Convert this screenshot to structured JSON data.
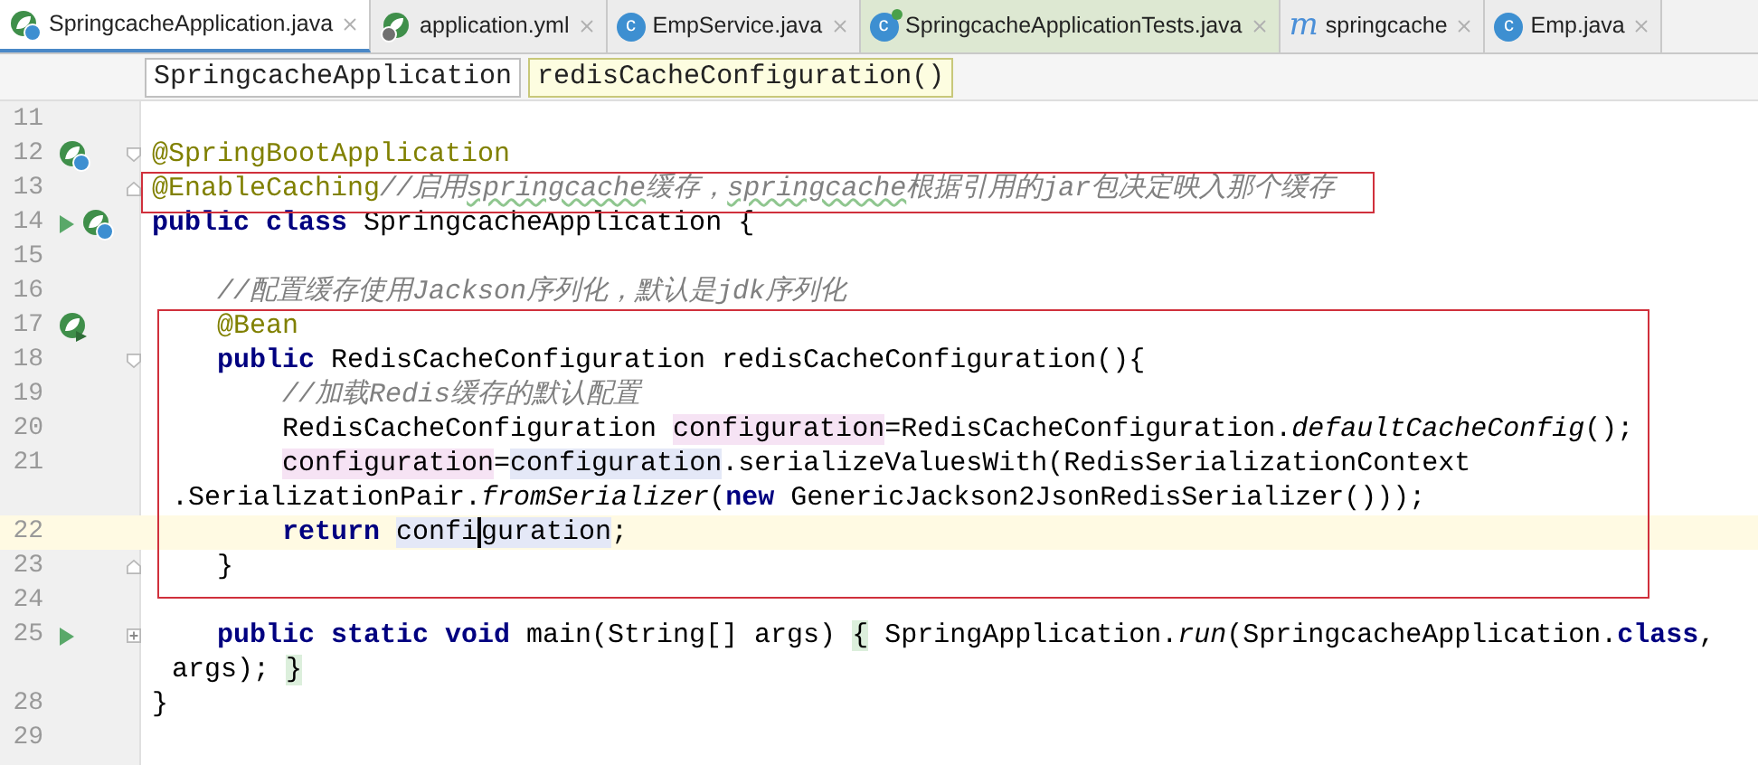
{
  "tabs": [
    {
      "label": "SpringcacheApplication.java",
      "kind": "spring-class",
      "selected": true,
      "color": "#ffffff"
    },
    {
      "label": "application.yml",
      "kind": "spring-config",
      "selected": false,
      "color": "#ececec"
    },
    {
      "label": "EmpService.java",
      "kind": "class",
      "icon_text": "c",
      "selected": false,
      "color": "#ececec"
    },
    {
      "label": "SpringcacheApplicationTests.java",
      "kind": "test-class",
      "icon_text": "c",
      "selected": false,
      "color": "#dde8d2"
    },
    {
      "label": "springcache",
      "kind": "module",
      "icon_text": "m",
      "selected": false,
      "color": "#ececec"
    },
    {
      "label": "Emp.java",
      "kind": "class",
      "icon_text": "c",
      "selected": false,
      "color": "#ececec"
    }
  ],
  "breadcrumbs": [
    {
      "label": "SpringcacheApplication",
      "selected": false
    },
    {
      "label": "redisCacheConfiguration()",
      "selected": true
    }
  ],
  "rows": [
    {
      "kind": "top",
      "number": "11",
      "current": false
    },
    {
      "kind": "top",
      "number": "12",
      "current": false,
      "gutter": [
        {
          "kind": "spring-class"
        }
      ],
      "fold": {
        "kind": "open"
      },
      "segments": [
        {
          "text": "@SpringBootApplication",
          "kind": "annotation"
        }
      ]
    },
    {
      "kind": "top",
      "number": "13",
      "current": false,
      "fold": {
        "kind": "close"
      },
      "box": {
        "kind": "tight"
      },
      "segments": [
        {
          "text": "@EnableCaching",
          "kind": "annotation"
        },
        {
          "text": "//启用",
          "kind": "comment"
        },
        {
          "text": "springcache",
          "kind": "comment",
          "typo": true
        },
        {
          "text": "缓存，",
          "kind": "comment"
        },
        {
          "text": "springcache",
          "kind": "comment",
          "typo": true
        },
        {
          "text": "根据引用的jar包决定映入那个缓存",
          "kind": "comment"
        }
      ]
    },
    {
      "kind": "top",
      "number": "14",
      "current": false,
      "gutter": [
        {
          "kind": "run"
        },
        {
          "kind": "spring-class"
        }
      ],
      "segments": [
        {
          "text": "public class",
          "kind": "keyword"
        },
        {
          "text": " SpringcacheApplication {",
          "kind": "plain"
        }
      ]
    },
    {
      "kind": "top",
      "number": "15",
      "current": false
    },
    {
      "kind": "member",
      "number": "16",
      "current": false,
      "segments": [
        {
          "text": "//配置缓存使用Jackson序列化，默认是jdk序列化",
          "kind": "comment"
        }
      ]
    },
    {
      "kind": "member",
      "number": "17",
      "current": false,
      "gutter": [
        {
          "kind": "bean-method"
        }
      ],
      "box": {
        "kind": "wide"
      },
      "segments": [
        {
          "text": "@Bean",
          "kind": "annotation"
        }
      ]
    },
    {
      "kind": "member",
      "number": "18",
      "current": false,
      "fold": {
        "kind": "open"
      },
      "box": {
        "kind": "wide"
      },
      "segments": [
        {
          "text": "public",
          "kind": "keyword"
        },
        {
          "text": " RedisCacheConfiguration redisCacheConfiguration(){",
          "kind": "plain"
        }
      ]
    },
    {
      "kind": "body",
      "number": "19",
      "current": false,
      "box": {
        "kind": "wide"
      },
      "segments": [
        {
          "text": "//加载Redis缓存的默认配置",
          "kind": "comment"
        }
      ]
    },
    {
      "kind": "body",
      "number": "20",
      "current": false,
      "box": {
        "kind": "wide"
      },
      "segments": [
        {
          "text": "RedisCacheConfiguration ",
          "kind": "plain"
        },
        {
          "text": "configuration",
          "kind": "write"
        },
        {
          "text": "=RedisCacheConfiguration.",
          "kind": "plain"
        },
        {
          "text": "defaultCacheConfig",
          "kind": "static"
        },
        {
          "text": "();",
          "kind": "plain"
        }
      ]
    },
    {
      "kind": "body",
      "number": "21",
      "current": false,
      "box": {
        "kind": "wide"
      },
      "segments": [
        {
          "text": "configuration",
          "kind": "write"
        },
        {
          "text": "=",
          "kind": "plain"
        },
        {
          "text": "configuration",
          "kind": "read"
        },
        {
          "text": ".serializeValuesWith(RedisSerializationContext",
          "kind": "plain"
        }
      ]
    },
    {
      "kind": "wrap",
      "current": false,
      "box": {
        "kind": "wide"
      },
      "segments": [
        {
          "text": ".SerializationPair.",
          "kind": "plain"
        },
        {
          "text": "fromSerializer",
          "kind": "static"
        },
        {
          "text": "(",
          "kind": "plain"
        },
        {
          "text": "new",
          "kind": "keyword"
        },
        {
          "text": " GenericJackson2JsonRedisSerializer()));",
          "kind": "plain"
        }
      ]
    },
    {
      "kind": "body",
      "number": "22",
      "current": true,
      "box": {
        "kind": "wide"
      },
      "segments": [
        {
          "text": "return ",
          "kind": "keyword"
        },
        {
          "text": "confi",
          "kind": "read"
        },
        {
          "text": "guration",
          "kind": "read",
          "caret": true
        },
        {
          "text": ";",
          "kind": "plain"
        }
      ]
    },
    {
      "kind": "member",
      "number": "23",
      "current": false,
      "fold": {
        "kind": "close"
      },
      "box": {
        "kind": "wide"
      },
      "segments": [
        {
          "text": "}",
          "kind": "plain"
        }
      ]
    },
    {
      "kind": "top",
      "number": "24",
      "current": false
    },
    {
      "kind": "member",
      "number": "25",
      "current": false,
      "gutter": [
        {
          "kind": "run"
        }
      ],
      "fold": {
        "kind": "collapsed"
      },
      "segments": [
        {
          "text": "public static void",
          "kind": "keyword"
        },
        {
          "text": " main(String[] args) ",
          "kind": "plain"
        },
        {
          "text": "{",
          "kind": "brace"
        },
        {
          "text": " SpringApplication.",
          "kind": "plain"
        },
        {
          "text": "run",
          "kind": "static"
        },
        {
          "text": "(SpringcacheApplication.",
          "kind": "plain"
        },
        {
          "text": "class",
          "kind": "keyword"
        },
        {
          "text": ",",
          "kind": "plain"
        }
      ]
    },
    {
      "kind": "wrap",
      "current": false,
      "segments": [
        {
          "text": "args); ",
          "kind": "plain"
        },
        {
          "text": "}",
          "kind": "brace"
        }
      ]
    },
    {
      "kind": "top",
      "number": "28",
      "current": false,
      "segments": [
        {
          "text": "}",
          "kind": "plain"
        }
      ]
    },
    {
      "kind": "top",
      "number": "29",
      "current": false
    }
  ]
}
